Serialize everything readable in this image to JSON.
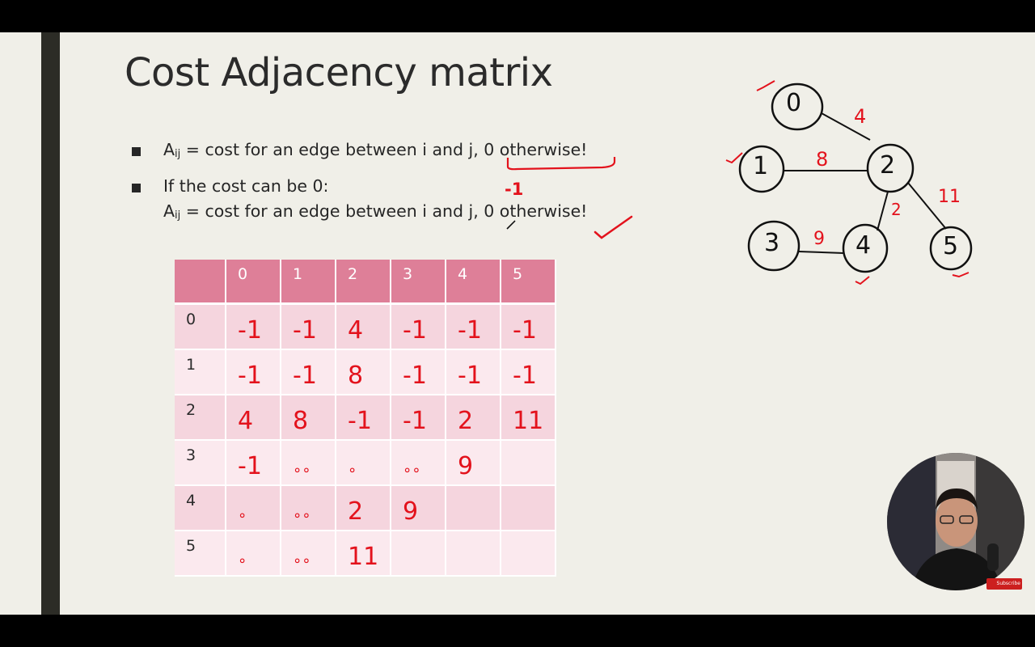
{
  "slide": {
    "title": "Cost Adjacency matrix",
    "bullets": {
      "b1": {
        "prefix": "A",
        "sub": "ij",
        "text": " = cost for an edge between i and j, 0 otherwise!"
      },
      "b2_line1": "If the cost can be 0:",
      "b2_line2": {
        "prefix": "A",
        "sub": "ij",
        "text": " = cost for an edge between i and j, 0 otherwise!"
      }
    },
    "annotation_minus_one": "-1"
  },
  "matrix": {
    "columns": [
      "0",
      "1",
      "2",
      "3",
      "4",
      "5"
    ],
    "rows": [
      {
        "label": "0",
        "cells": [
          "-1",
          "-1",
          "4",
          "-1",
          "-1",
          "-1"
        ]
      },
      {
        "label": "1",
        "cells": [
          "-1",
          "-1",
          "8",
          "-1",
          "-1",
          "-1"
        ]
      },
      {
        "label": "2",
        "cells": [
          "4",
          "8",
          "-1",
          "-1",
          "2",
          "11"
        ]
      },
      {
        "label": "3",
        "cells": [
          "-1",
          "∘∘",
          "∘",
          "∘∘",
          "9",
          ""
        ]
      },
      {
        "label": "4",
        "cells": [
          "∘",
          "∘∘",
          "2",
          "9",
          "",
          ""
        ]
      },
      {
        "label": "5",
        "cells": [
          "∘",
          "∘∘",
          "11",
          "",
          "",
          ""
        ]
      }
    ]
  },
  "graph": {
    "nodes": [
      "0",
      "1",
      "2",
      "3",
      "4",
      "5"
    ],
    "edge_weights": {
      "e02": "4",
      "e12": "8",
      "e24": "2",
      "e25": "11",
      "e34": "9"
    }
  },
  "colors": {
    "ink": "#e3121c",
    "header": "#de7f98",
    "row_odd": "#f5d5de",
    "row_even": "#fbe9ee",
    "slide_bg": "#f0efe8"
  },
  "youtube": {
    "subscribe": "Subscribe"
  }
}
